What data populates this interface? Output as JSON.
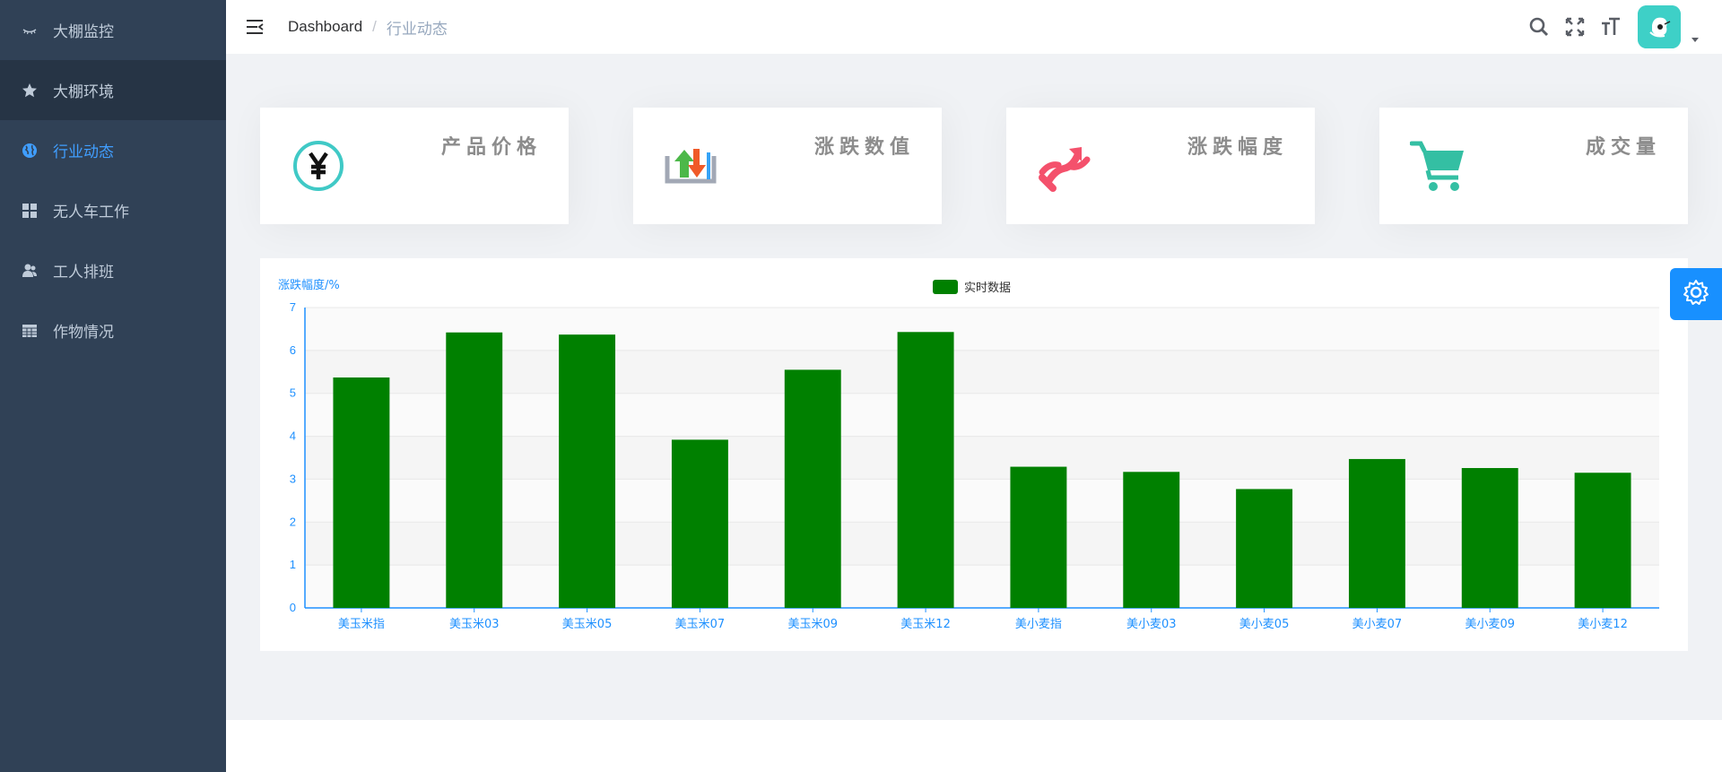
{
  "sidebar": {
    "items": [
      {
        "label": "大棚监控",
        "icon": "eye-closed-icon"
      },
      {
        "label": "大棚环境",
        "icon": "star-icon"
      },
      {
        "label": "行业动态",
        "icon": "globe-icon"
      },
      {
        "label": "无人车工作",
        "icon": "dashboard-grid-icon"
      },
      {
        "label": "工人排班",
        "icon": "people-icon"
      },
      {
        "label": "作物情况",
        "icon": "table-icon"
      }
    ],
    "active_index": 2,
    "hover_index": 1
  },
  "breadcrumb": {
    "home": "Dashboard",
    "separator": "/",
    "current": "行业动态"
  },
  "panels": [
    {
      "title": "产品价格",
      "icon": "yen-icon",
      "color": "#40c9c6"
    },
    {
      "title": "涨跌数值",
      "icon": "bar-updown-icon",
      "color": "#36a3f7"
    },
    {
      "title": "涨跌幅度",
      "icon": "swap-arrows-icon",
      "color": "#f4516c"
    },
    {
      "title": "成交量",
      "icon": "shopping-cart-icon",
      "color": "#34bfa3"
    }
  ],
  "colors": {
    "sidebar_bg": "#304156",
    "sidebar_text": "#bfcbd9",
    "sidebar_active": "#409eff",
    "main_bg": "#f0f2f5",
    "bar": "#008000",
    "axis": "#1e90ff",
    "settings_bg": "#1890ff"
  },
  "chart_data": {
    "type": "bar",
    "title": "",
    "ylabel": "涨跌幅度/%",
    "xlabel": "",
    "legend": {
      "position": "top-center"
    },
    "ylim": [
      0,
      7
    ],
    "yticks": [
      0,
      1,
      2,
      3,
      4,
      5,
      6,
      7
    ],
    "grid": true,
    "categories": [
      "美玉米指",
      "美玉米03",
      "美玉米05",
      "美玉米07",
      "美玉米09",
      "美玉米12",
      "美小麦指",
      "美小麦03",
      "美小麦05",
      "美小麦07",
      "美小麦09",
      "美小麦12"
    ],
    "series": [
      {
        "name": "实时数据",
        "color": "#008000",
        "values": [
          5.37,
          6.42,
          6.37,
          3.92,
          5.55,
          6.43,
          3.29,
          3.17,
          2.77,
          3.47,
          3.26,
          3.15
        ]
      }
    ]
  }
}
